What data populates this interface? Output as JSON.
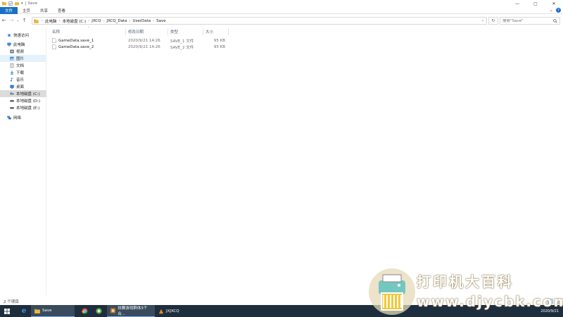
{
  "window": {
    "title": "Save",
    "controls": [
      "—",
      "▢",
      "✕"
    ]
  },
  "ribbon": {
    "tabs": [
      "文件",
      "主页",
      "共享",
      "查看"
    ],
    "help": "?"
  },
  "address": {
    "crumbs": [
      "此电脑",
      "本地磁盘 (C:)",
      "JXCQ",
      "JXCQ_Data",
      "UserData",
      "Save"
    ],
    "search_placeholder": "搜索\"Save\""
  },
  "sidebar": {
    "items": [
      {
        "label": "快速访问",
        "icon": "star-icon"
      },
      {
        "label": "此电脑",
        "icon": "computer-icon"
      },
      {
        "label": "视频",
        "icon": "video-folder-icon"
      },
      {
        "label": "图片",
        "icon": "pictures-folder-icon"
      },
      {
        "label": "文档",
        "icon": "documents-folder-icon"
      },
      {
        "label": "下载",
        "icon": "downloads-folder-icon"
      },
      {
        "label": "音乐",
        "icon": "music-folder-icon"
      },
      {
        "label": "桌面",
        "icon": "desktop-folder-icon"
      },
      {
        "label": "本地磁盘 (C:)",
        "icon": "drive-icon"
      },
      {
        "label": "本地磁盘 (D:)",
        "icon": "drive-icon"
      },
      {
        "label": "本地磁盘 (E:)",
        "icon": "drive-icon"
      },
      {
        "label": "网络",
        "icon": "network-icon"
      }
    ]
  },
  "file_list": {
    "columns": [
      "名称",
      "修改日期",
      "类型",
      "大小"
    ],
    "rows": [
      {
        "name": "GameData.save_1",
        "modified": "2020/9/21 14:26",
        "type": "SAVE_1 文件",
        "size": "95 KB"
      },
      {
        "name": "GameData.save_2",
        "modified": "2020/9/21 14:26",
        "type": "SAVE_2 文件",
        "size": "95 KB"
      }
    ]
  },
  "status": {
    "item_count": "2 个项目"
  },
  "taskbar": {
    "apps": [
      {
        "label": "Save"
      },
      {
        "label": "炫舞游戏群体3个合..."
      },
      {
        "label": "JXJXCQ"
      }
    ],
    "date": "2020/9/21"
  },
  "watermark": {
    "line1": "打印机大百科",
    "line2": "www.djycbk.com"
  },
  "colors": {
    "accent": "#1a70c4",
    "taskbar": "#1f2e3d",
    "folder": "#e8b843"
  }
}
